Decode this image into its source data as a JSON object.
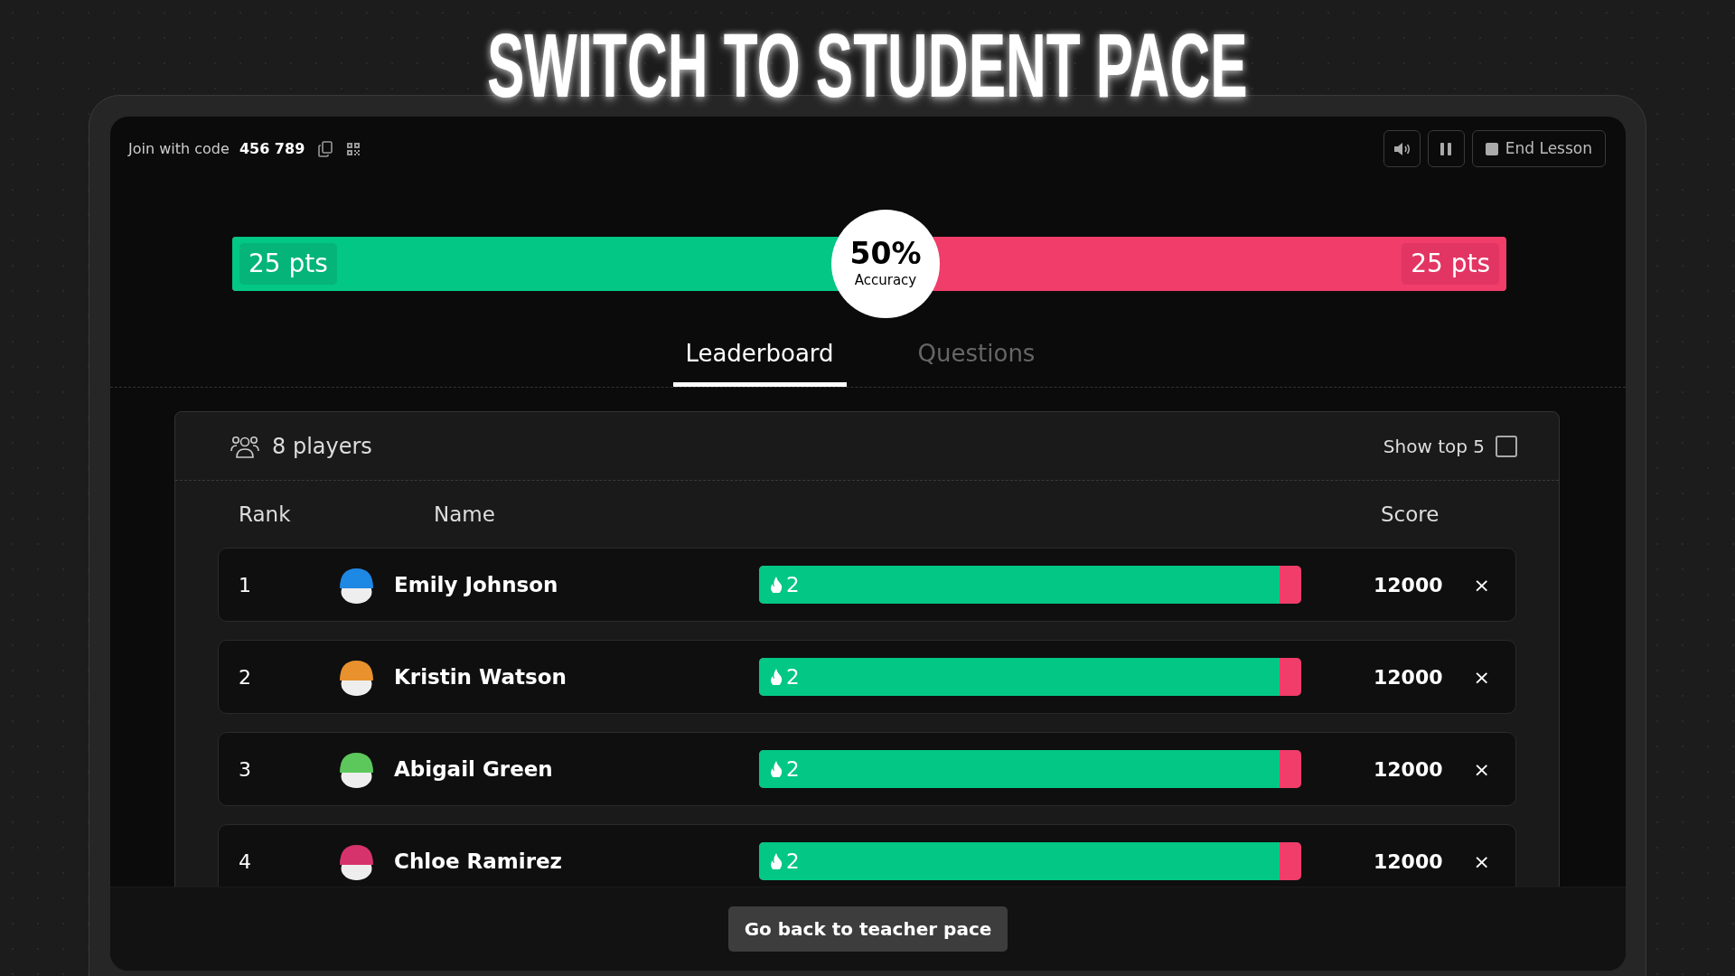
{
  "title": "SWITCH TO STUDENT PACE",
  "topbar": {
    "join_label": "Join with code",
    "code": "456 789",
    "end_button": "End Lesson"
  },
  "accuracy": {
    "percent": "50%",
    "label": "Accuracy",
    "correct_pts": "25 pts",
    "incorrect_pts": "25 pts"
  },
  "tabs": [
    {
      "label": "Leaderboard",
      "selected": true
    },
    {
      "label": "Questions",
      "selected": false
    }
  ],
  "leaderboard": {
    "player_count": "8 players",
    "show_top": {
      "label": "Show top 5",
      "checked": false
    },
    "columns": [
      "Rank",
      "Name",
      "Score"
    ],
    "rows": [
      {
        "rank": "1",
        "name": "Emily Johnson",
        "color": "#1e88e5",
        "streak": "2",
        "level": 0.96,
        "score": "12000",
        "remove": "×"
      },
      {
        "rank": "2",
        "name": "Kristin Watson",
        "color": "#e8912d",
        "streak": "2",
        "level": 0.96,
        "score": "12000",
        "remove": "×"
      },
      {
        "rank": "3",
        "name": "Abigail Green",
        "color": "#5cc85c",
        "streak": "2",
        "level": 0.96,
        "score": "12000",
        "remove": "×"
      },
      {
        "rank": "4",
        "name": "Chloe Ramirez",
        "color": "#d6336c",
        "streak": "2",
        "level": 0.96,
        "score": "12000",
        "remove": "×"
      }
    ]
  },
  "footer_button": "Go back to teacher pace"
}
